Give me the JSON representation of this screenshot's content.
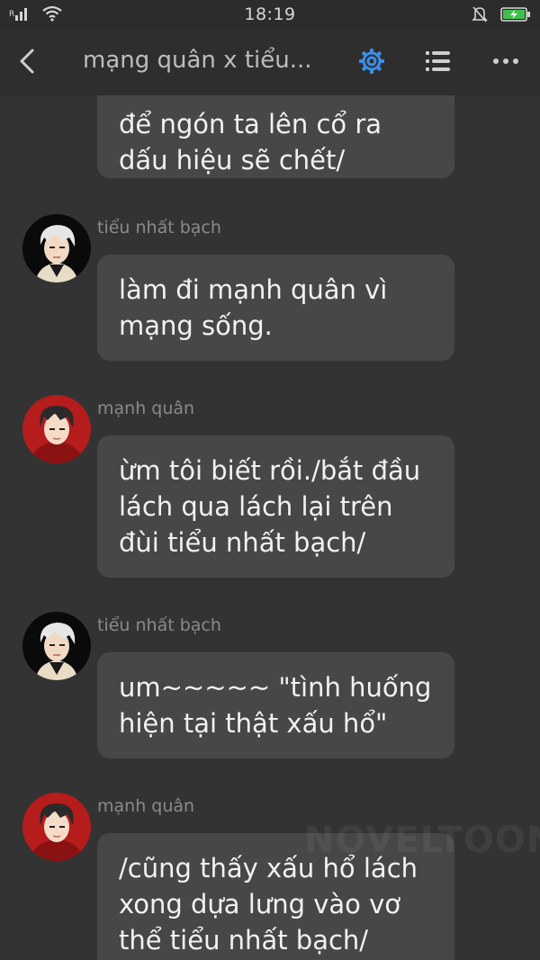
{
  "status_bar": {
    "time": "18:19"
  },
  "header": {
    "title": "mạng quân x tiểu...",
    "accent": "#3b8de8"
  },
  "messages": [
    {
      "sender": "",
      "text": "để ngón ta lên cổ ra\ndấu hiệu sẽ chết/"
    },
    {
      "sender": "tiểu nhất bạch",
      "text": "làm đi mạnh quân vì\nmạng sống."
    },
    {
      "sender": "mạnh quân",
      "text": "ừm tôi biết rồi./bắt đầu\nlách qua lách lại trên\nđùi tiểu nhất bạch/"
    },
    {
      "sender": "tiểu nhất bạch",
      "text": "um~~~~~ \"tình huống\nhiện tại thật xấu hổ\""
    },
    {
      "sender": "mạnh quân",
      "text": "/cũng thấy xấu hổ lách\nxong dựa lưng vào vơ\nthể tiểu nhất bạch/"
    }
  ],
  "watermark": "NOVELTOON"
}
